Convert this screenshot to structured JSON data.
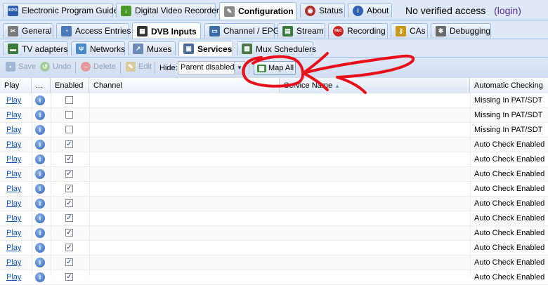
{
  "top_tabs": [
    {
      "label": "Electronic Program Guide",
      "icon": "epg-icon",
      "icon_text": "EPG",
      "color": "#2b5fb0"
    },
    {
      "label": "Digital Video Recorder",
      "icon": "download-icon",
      "icon_text": "↓",
      "color": "#4a9a2a"
    },
    {
      "label": "Configuration",
      "icon": "wrench-icon",
      "icon_text": "🔧",
      "color": "#888888"
    },
    {
      "label": "Status",
      "icon": "eye-icon",
      "icon_text": "◉",
      "color": "#b03030"
    },
    {
      "label": "About",
      "icon": "info-icon",
      "icon_text": "i",
      "color": "#2d62b4"
    }
  ],
  "auth": {
    "text": "No verified access",
    "login": "(login)"
  },
  "config_tabs": [
    {
      "label": "General",
      "icon": "tools-icon",
      "icon_text": "✂",
      "color": "#7a7a7a"
    },
    {
      "label": "Access Entries",
      "icon": "users-icon",
      "icon_text": "👥",
      "color": "#4a7ab8"
    },
    {
      "label": "DVB Inputs",
      "icon": "film-icon",
      "icon_text": "▦",
      "color": "#333333"
    },
    {
      "label": "Channel / EPG",
      "icon": "tv-icon",
      "icon_text": "▭",
      "color": "#3a6ea5"
    },
    {
      "label": "Stream",
      "icon": "stream-icon",
      "icon_text": "▤",
      "color": "#3a7a3a"
    },
    {
      "label": "Recording",
      "icon": "rec-icon",
      "icon_text": "REC",
      "color": "#cc2222"
    },
    {
      "label": "CAs",
      "icon": "key-icon",
      "icon_text": "⚷",
      "color": "#c99a1a"
    },
    {
      "label": "Debugging",
      "icon": "bug-icon",
      "icon_text": "✱",
      "color": "#6a6a6a"
    }
  ],
  "dvb_tabs": [
    {
      "label": "TV adapters",
      "icon": "adapter-icon",
      "icon_text": "▬",
      "color": "#3a7a3a"
    },
    {
      "label": "Networks",
      "icon": "antenna-icon",
      "icon_text": "Ψ",
      "color": "#4a8ac8"
    },
    {
      "label": "Muxes",
      "icon": "mux-icon",
      "icon_text": "↗",
      "color": "#6a8ab8"
    },
    {
      "label": "Services",
      "icon": "services-icon",
      "icon_text": "▣",
      "color": "#4a6a9a"
    },
    {
      "label": "Mux Schedulers",
      "icon": "calendar-icon",
      "icon_text": "▦",
      "color": "#4a7a4a"
    }
  ],
  "toolbar": {
    "save": "Save",
    "undo": "Undo",
    "delete": "Delete",
    "edit": "Edit",
    "hide_label": "Hide:",
    "hide_value": "Parent disabled",
    "map_all": "Map All"
  },
  "columns": {
    "play": "Play",
    "dots": "...",
    "enabled": "Enabled",
    "channel": "Channel",
    "service_name": "Service Name",
    "automatic_checking": "Automatic Checking"
  },
  "rows": [
    {
      "play": "Play",
      "enabled": false,
      "check": "Missing In PAT/SDT"
    },
    {
      "play": "Play",
      "enabled": false,
      "check": "Missing In PAT/SDT"
    },
    {
      "play": "Play",
      "enabled": false,
      "check": "Missing In PAT/SDT"
    },
    {
      "play": "Play",
      "enabled": true,
      "check": "Auto Check Enabled"
    },
    {
      "play": "Play",
      "enabled": true,
      "check": "Auto Check Enabled"
    },
    {
      "play": "Play",
      "enabled": true,
      "check": "Auto Check Enabled"
    },
    {
      "play": "Play",
      "enabled": true,
      "check": "Auto Check Enabled"
    },
    {
      "play": "Play",
      "enabled": true,
      "check": "Auto Check Enabled"
    },
    {
      "play": "Play",
      "enabled": true,
      "check": "Auto Check Enabled"
    },
    {
      "play": "Play",
      "enabled": true,
      "check": "Auto Check Enabled"
    },
    {
      "play": "Play",
      "enabled": true,
      "check": "Auto Check Enabled"
    },
    {
      "play": "Play",
      "enabled": true,
      "check": "Auto Check Enabled"
    },
    {
      "play": "Play",
      "enabled": true,
      "check": "Auto Check Enabled"
    }
  ],
  "annotation_color": "#e8101a"
}
